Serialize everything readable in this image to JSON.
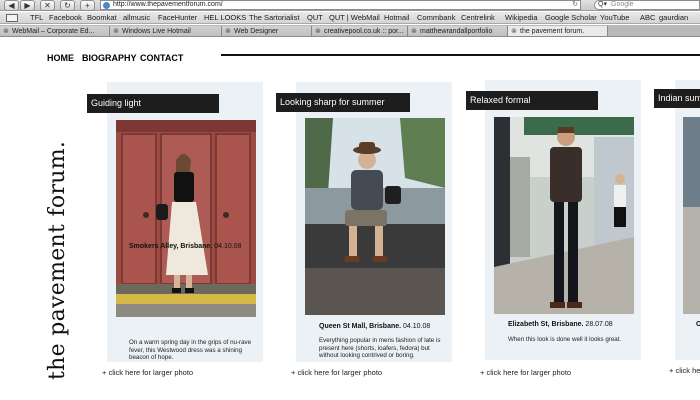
{
  "browser": {
    "url": "http://www.thepavementforum.com/",
    "search_placeholder": "Google",
    "bookmarks": [
      "TFL",
      "Facebook",
      "Boomkat",
      "allmusic",
      "FaceHunter",
      "HEL LOOKS",
      "The Sartorialist",
      "QUT",
      "QUT | WebMail",
      "Hotmail",
      "Commbank",
      "Centrelink",
      "Wikipedia",
      "Google Scholar",
      "YouTube",
      "ABC",
      "gaurdian"
    ],
    "tabs": [
      "WebMail – Corporate Ed...",
      "Windows Live Hotmail",
      "Web Designer",
      "creativepool.co.uk :: por...",
      "matthewrandallportfolio",
      "the pavement forum."
    ]
  },
  "site": {
    "logo_text": "the pavement forum.",
    "nav": [
      "HOME",
      "BIOGRAPHY",
      "CONTACT"
    ]
  },
  "cards": [
    {
      "title": "Guiding light",
      "location": "Smokers Alley, Brisbane.",
      "date": "04.10.08",
      "caption": "On a warm spring day in the grips of nu-rave fever, this Westwood dress was a shining beacon of hope.",
      "link": "+ click here for larger photo"
    },
    {
      "title": "Looking sharp for summer",
      "location": "Queen St Mall, Brisbane.",
      "date": "04.10.08",
      "caption": "Everything popular in mens fashion of late is present here (shorts, loafers, fedora) but without looking contrived or boring.",
      "link": "+ click here for larger photo"
    },
    {
      "title": "Relaxed formal",
      "location": "Elizabeth St, Brisbane.",
      "date": "28.07.08",
      "caption": "When this look is done well it looks great.",
      "link": "+ click here for larger photo"
    },
    {
      "title": "Indian sum",
      "location": "C",
      "caption": "",
      "link": "+ click he"
    }
  ],
  "colors": {
    "card_bg": "#ebf1f5",
    "title_bg": "#1d1d1d",
    "text": "#111111"
  }
}
